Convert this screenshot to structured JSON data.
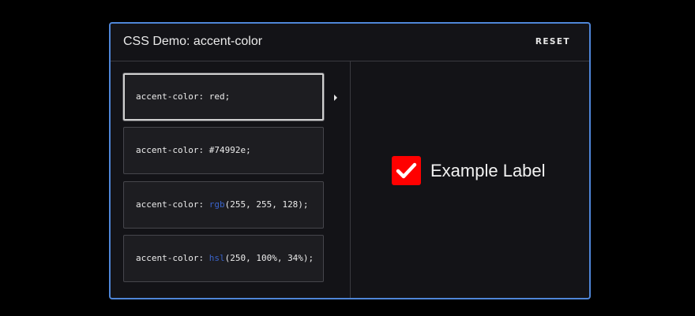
{
  "header": {
    "title": "CSS Demo: accent-color",
    "reset_label": "RESET"
  },
  "options": [
    {
      "prop": "accent-color: ",
      "fn": "",
      "value": "red;",
      "selected": true
    },
    {
      "prop": "accent-color: ",
      "fn": "",
      "value": "#74992e;",
      "selected": false
    },
    {
      "prop": "accent-color: ",
      "fn": "rgb",
      "value": "(255, 255, 128);",
      "selected": false
    },
    {
      "prop": "accent-color: ",
      "fn": "hsl",
      "value": "(250, 100%, 34%);",
      "selected": false
    }
  ],
  "example": {
    "label": "Example Label",
    "checked": true,
    "accent": "#ff0000"
  },
  "colors": {
    "frame_border": "#4f86d8",
    "background": "#131317",
    "option_background": "#1d1d21",
    "function_name": "#3a63c9"
  }
}
